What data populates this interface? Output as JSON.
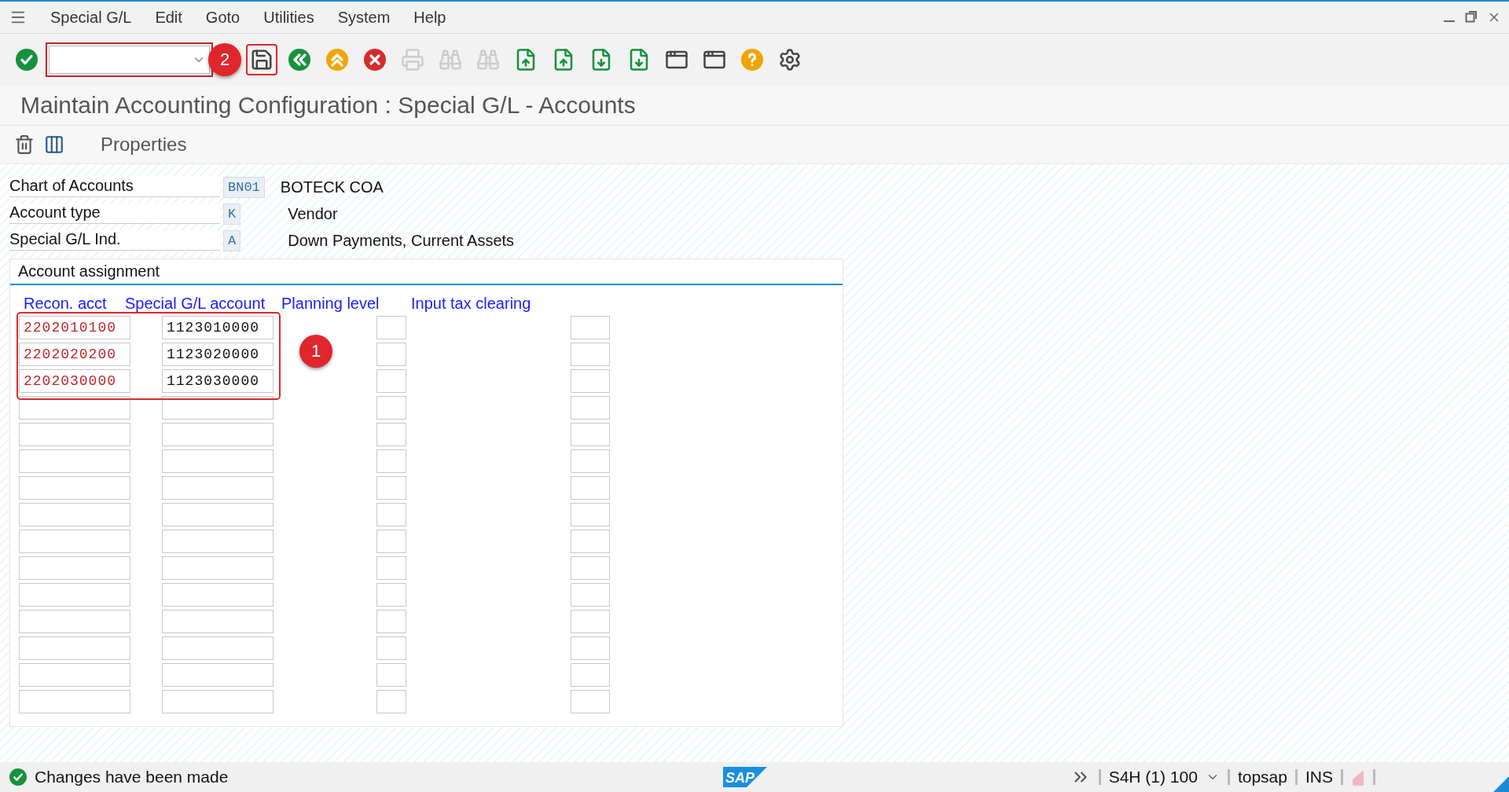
{
  "menu": [
    {
      "label": "Special G/L"
    },
    {
      "label": "Edit"
    },
    {
      "label": "Goto"
    },
    {
      "label": "Utilities"
    },
    {
      "label": "System"
    },
    {
      "label": "Help"
    }
  ],
  "toolbar": [
    {
      "kind": "enter",
      "disabled": false
    },
    {
      "kind": "command"
    },
    {
      "kind": "save",
      "disabled": false
    },
    {
      "kind": "back",
      "disabled": false
    },
    {
      "kind": "exit",
      "disabled": false
    },
    {
      "kind": "cancel",
      "disabled": false
    },
    {
      "kind": "print",
      "disabled": true
    },
    {
      "kind": "find",
      "disabled": true
    },
    {
      "kind": "find-next",
      "disabled": true
    },
    {
      "kind": "first-page",
      "disabled": false
    },
    {
      "kind": "prev-page",
      "disabled": false
    },
    {
      "kind": "next-page",
      "disabled": false
    },
    {
      "kind": "last-page",
      "disabled": false
    },
    {
      "kind": "new-window",
      "disabled": false
    },
    {
      "kind": "shortcut",
      "disabled": false
    },
    {
      "kind": "help",
      "disabled": false
    },
    {
      "kind": "settings",
      "disabled": false
    }
  ],
  "annotations": [
    {
      "label": "1"
    },
    {
      "label": "2"
    }
  ],
  "title": "Maintain Accounting Configuration : Special G/L - Accounts",
  "app_toolbar": {
    "properties": "Properties"
  },
  "header": [
    {
      "label": "Chart of Accounts",
      "value": "BN01",
      "description": "BOTECK COA"
    },
    {
      "label": "Account type",
      "value": "K",
      "description": "Vendor"
    },
    {
      "label": "Special G/L Ind.",
      "value": "A",
      "description": "Down Payments, Current Assets"
    }
  ],
  "account_assignment": {
    "title": "Account assignment",
    "columns": [
      "Recon. acct",
      "Special G/L account",
      "Planning level",
      "Input tax clearing"
    ],
    "rows": [
      {
        "recon_acct": "2202010100",
        "special_gl_account": "1123010000",
        "planning_level": false,
        "input_tax_clearing": false,
        "highlighted": true
      },
      {
        "recon_acct": "2202020200",
        "special_gl_account": "1123020000",
        "planning_level": false,
        "input_tax_clearing": false,
        "highlighted": true
      },
      {
        "recon_acct": "2202030000",
        "special_gl_account": "1123030000",
        "planning_level": false,
        "input_tax_clearing": false,
        "highlighted": true
      },
      {
        "planning_level": false,
        "input_tax_clearing": false,
        "highlighted": false
      },
      {
        "planning_level": false,
        "input_tax_clearing": false,
        "highlighted": false
      },
      {
        "planning_level": false,
        "input_tax_clearing": false,
        "highlighted": false
      },
      {
        "planning_level": false,
        "input_tax_clearing": false,
        "highlighted": false
      },
      {
        "planning_level": false,
        "input_tax_clearing": false,
        "highlighted": false
      },
      {
        "planning_level": false,
        "input_tax_clearing": false,
        "highlighted": false
      },
      {
        "planning_level": false,
        "input_tax_clearing": false,
        "highlighted": false
      },
      {
        "planning_level": false,
        "input_tax_clearing": false,
        "highlighted": false
      },
      {
        "planning_level": false,
        "input_tax_clearing": false,
        "highlighted": false
      },
      {
        "planning_level": false,
        "input_tax_clearing": false,
        "highlighted": false
      },
      {
        "planning_level": false,
        "input_tax_clearing": false,
        "highlighted": false
      },
      {
        "planning_level": false,
        "input_tax_clearing": false,
        "highlighted": false
      }
    ]
  },
  "status_bar": {
    "message": "Changes have been made",
    "logo": "SAP",
    "system": "S4H (1) 100",
    "server": "topsap",
    "mode": "INS"
  }
}
